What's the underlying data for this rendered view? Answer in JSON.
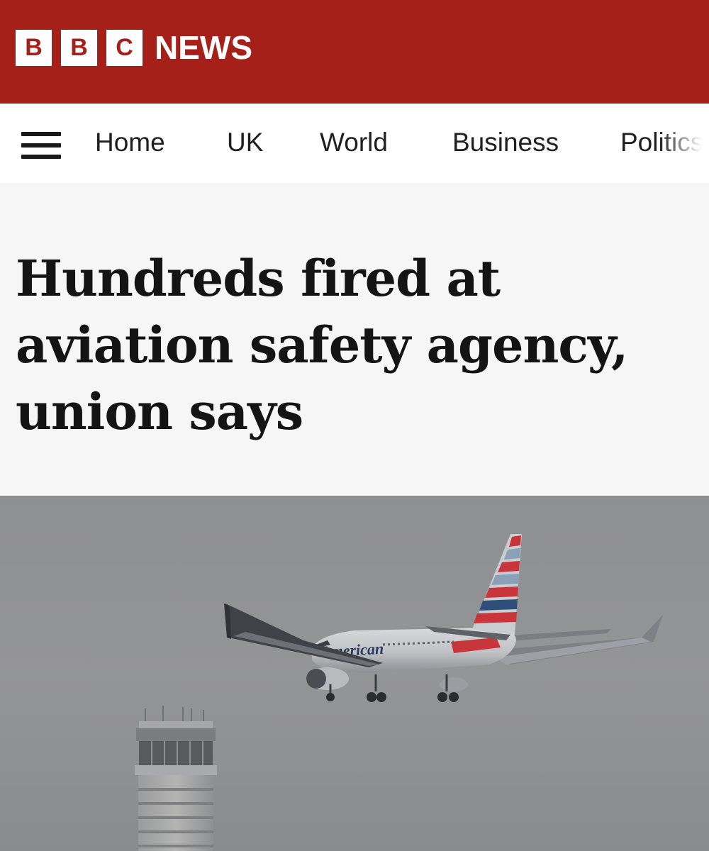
{
  "masthead": {
    "logo_letters": [
      "B",
      "B",
      "C"
    ],
    "logo_word": "NEWS",
    "brand_color": "#a6201a"
  },
  "nav": {
    "menu_icon": "hamburger-menu-icon",
    "items": [
      "Home",
      "UK",
      "World",
      "Business",
      "Politics"
    ]
  },
  "article": {
    "headline": "Hundreds fired at aviation safety agency, union says",
    "hero_image": {
      "subject": "airplane-landing-near-control-tower",
      "airline_livery_text": "American"
    }
  }
}
